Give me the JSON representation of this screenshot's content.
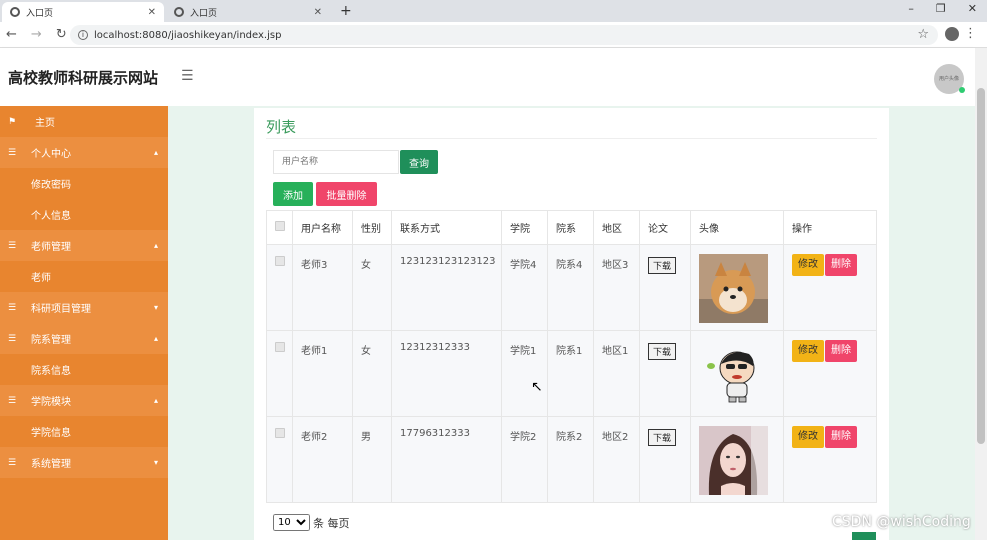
{
  "browser": {
    "tabs": [
      {
        "title": "入口页",
        "active": true
      },
      {
        "title": "入口页",
        "active": false
      }
    ],
    "new_tab": "+",
    "url": "localhost:8080/jiaoshikeyan/index.jsp",
    "window_controls": [
      "–",
      "❐",
      "✕"
    ]
  },
  "header": {
    "site_title": "高校教师科研展示网站",
    "avatar_text": "用户头像"
  },
  "sidebar": {
    "items": [
      {
        "label": "主页",
        "type": "top",
        "icon": "flag-icon"
      },
      {
        "label": "个人中心",
        "type": "group",
        "icon": "list-icon"
      },
      {
        "label": "修改密码",
        "type": "sub"
      },
      {
        "label": "个人信息",
        "type": "sub"
      },
      {
        "label": "老师管理",
        "type": "group",
        "icon": "list-icon"
      },
      {
        "label": "老师",
        "type": "sub"
      },
      {
        "label": "科研项目管理",
        "type": "group",
        "icon": "list-icon"
      },
      {
        "label": "院系管理",
        "type": "group",
        "icon": "list-icon"
      },
      {
        "label": "院系信息",
        "type": "sub"
      },
      {
        "label": "学院模块",
        "type": "group",
        "icon": "list-icon"
      },
      {
        "label": "学院信息",
        "type": "sub"
      },
      {
        "label": "系统管理",
        "type": "group",
        "icon": "list-icon"
      }
    ]
  },
  "main": {
    "title": "列表",
    "search_placeholder": "用户名称",
    "search_button": "查询",
    "add_button": "添加",
    "batch_delete_button": "批量删除",
    "columns": [
      "用户名称",
      "性别",
      "联系方式",
      "学院",
      "院系",
      "地区",
      "论文",
      "头像",
      "操作"
    ],
    "rows": [
      {
        "name": "老师3",
        "gender": "女",
        "phone": "123123123123123",
        "college": "学院4",
        "dept": "院系4",
        "region": "地区3",
        "paper": "下载",
        "avatar": "dog"
      },
      {
        "name": "老师1",
        "gender": "女",
        "phone": "12312312333",
        "college": "学院1",
        "dept": "院系1",
        "region": "地区1",
        "paper": "下载",
        "avatar": "cartoon"
      },
      {
        "name": "老师2",
        "gender": "男",
        "phone": "17796312333",
        "college": "学院2",
        "dept": "院系2",
        "region": "地区2",
        "paper": "下载",
        "avatar": "girl"
      }
    ],
    "edit_label": "修改",
    "delete_label": "删除",
    "page_size": "10",
    "page_size_suffix": "条 每页"
  },
  "watermark": "CSDN @wishCoding",
  "colors": {
    "sidebar": "#e8852f",
    "accent_green": "#1f8f5a",
    "danger": "#f0456a",
    "warning": "#f2b316"
  }
}
